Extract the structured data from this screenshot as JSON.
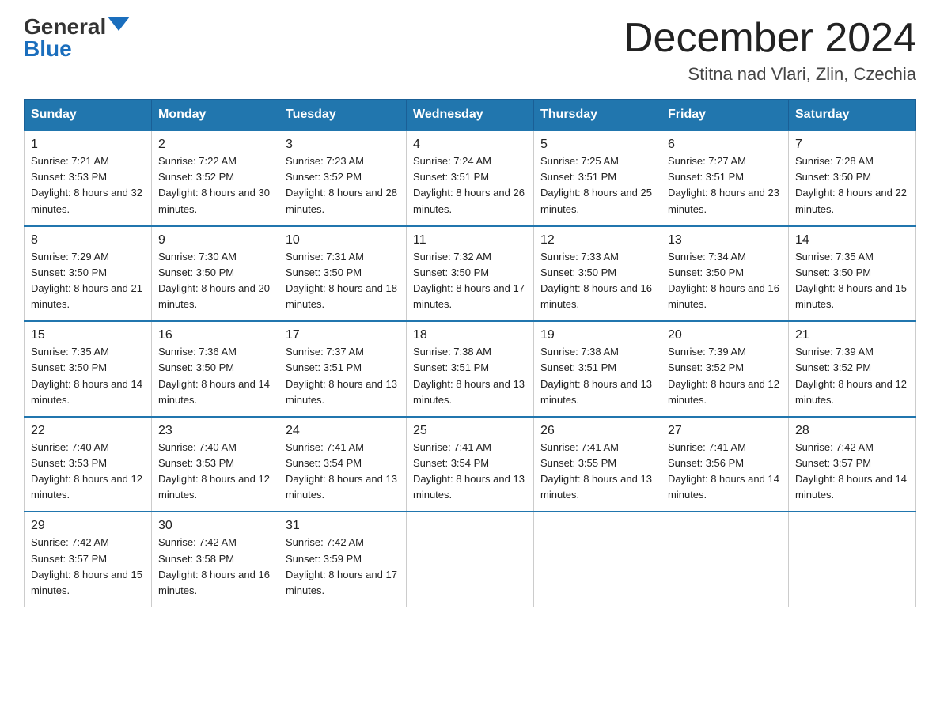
{
  "header": {
    "logo": {
      "general": "General",
      "arrow_shape": "triangle",
      "blue": "Blue"
    },
    "title": "December 2024",
    "location": "Stitna nad Vlari, Zlin, Czechia"
  },
  "calendar": {
    "weekdays": [
      "Sunday",
      "Monday",
      "Tuesday",
      "Wednesday",
      "Thursday",
      "Friday",
      "Saturday"
    ],
    "weeks": [
      [
        {
          "day": "1",
          "sunrise": "7:21 AM",
          "sunset": "3:53 PM",
          "daylight": "8 hours and 32 minutes."
        },
        {
          "day": "2",
          "sunrise": "7:22 AM",
          "sunset": "3:52 PM",
          "daylight": "8 hours and 30 minutes."
        },
        {
          "day": "3",
          "sunrise": "7:23 AM",
          "sunset": "3:52 PM",
          "daylight": "8 hours and 28 minutes."
        },
        {
          "day": "4",
          "sunrise": "7:24 AM",
          "sunset": "3:51 PM",
          "daylight": "8 hours and 26 minutes."
        },
        {
          "day": "5",
          "sunrise": "7:25 AM",
          "sunset": "3:51 PM",
          "daylight": "8 hours and 25 minutes."
        },
        {
          "day": "6",
          "sunrise": "7:27 AM",
          "sunset": "3:51 PM",
          "daylight": "8 hours and 23 minutes."
        },
        {
          "day": "7",
          "sunrise": "7:28 AM",
          "sunset": "3:50 PM",
          "daylight": "8 hours and 22 minutes."
        }
      ],
      [
        {
          "day": "8",
          "sunrise": "7:29 AM",
          "sunset": "3:50 PM",
          "daylight": "8 hours and 21 minutes."
        },
        {
          "day": "9",
          "sunrise": "7:30 AM",
          "sunset": "3:50 PM",
          "daylight": "8 hours and 20 minutes."
        },
        {
          "day": "10",
          "sunrise": "7:31 AM",
          "sunset": "3:50 PM",
          "daylight": "8 hours and 18 minutes."
        },
        {
          "day": "11",
          "sunrise": "7:32 AM",
          "sunset": "3:50 PM",
          "daylight": "8 hours and 17 minutes."
        },
        {
          "day": "12",
          "sunrise": "7:33 AM",
          "sunset": "3:50 PM",
          "daylight": "8 hours and 16 minutes."
        },
        {
          "day": "13",
          "sunrise": "7:34 AM",
          "sunset": "3:50 PM",
          "daylight": "8 hours and 16 minutes."
        },
        {
          "day": "14",
          "sunrise": "7:35 AM",
          "sunset": "3:50 PM",
          "daylight": "8 hours and 15 minutes."
        }
      ],
      [
        {
          "day": "15",
          "sunrise": "7:35 AM",
          "sunset": "3:50 PM",
          "daylight": "8 hours and 14 minutes."
        },
        {
          "day": "16",
          "sunrise": "7:36 AM",
          "sunset": "3:50 PM",
          "daylight": "8 hours and 14 minutes."
        },
        {
          "day": "17",
          "sunrise": "7:37 AM",
          "sunset": "3:51 PM",
          "daylight": "8 hours and 13 minutes."
        },
        {
          "day": "18",
          "sunrise": "7:38 AM",
          "sunset": "3:51 PM",
          "daylight": "8 hours and 13 minutes."
        },
        {
          "day": "19",
          "sunrise": "7:38 AM",
          "sunset": "3:51 PM",
          "daylight": "8 hours and 13 minutes."
        },
        {
          "day": "20",
          "sunrise": "7:39 AM",
          "sunset": "3:52 PM",
          "daylight": "8 hours and 12 minutes."
        },
        {
          "day": "21",
          "sunrise": "7:39 AM",
          "sunset": "3:52 PM",
          "daylight": "8 hours and 12 minutes."
        }
      ],
      [
        {
          "day": "22",
          "sunrise": "7:40 AM",
          "sunset": "3:53 PM",
          "daylight": "8 hours and 12 minutes."
        },
        {
          "day": "23",
          "sunrise": "7:40 AM",
          "sunset": "3:53 PM",
          "daylight": "8 hours and 12 minutes."
        },
        {
          "day": "24",
          "sunrise": "7:41 AM",
          "sunset": "3:54 PM",
          "daylight": "8 hours and 13 minutes."
        },
        {
          "day": "25",
          "sunrise": "7:41 AM",
          "sunset": "3:54 PM",
          "daylight": "8 hours and 13 minutes."
        },
        {
          "day": "26",
          "sunrise": "7:41 AM",
          "sunset": "3:55 PM",
          "daylight": "8 hours and 13 minutes."
        },
        {
          "day": "27",
          "sunrise": "7:41 AM",
          "sunset": "3:56 PM",
          "daylight": "8 hours and 14 minutes."
        },
        {
          "day": "28",
          "sunrise": "7:42 AM",
          "sunset": "3:57 PM",
          "daylight": "8 hours and 14 minutes."
        }
      ],
      [
        {
          "day": "29",
          "sunrise": "7:42 AM",
          "sunset": "3:57 PM",
          "daylight": "8 hours and 15 minutes."
        },
        {
          "day": "30",
          "sunrise": "7:42 AM",
          "sunset": "3:58 PM",
          "daylight": "8 hours and 16 minutes."
        },
        {
          "day": "31",
          "sunrise": "7:42 AM",
          "sunset": "3:59 PM",
          "daylight": "8 hours and 17 minutes."
        },
        null,
        null,
        null,
        null
      ]
    ]
  }
}
